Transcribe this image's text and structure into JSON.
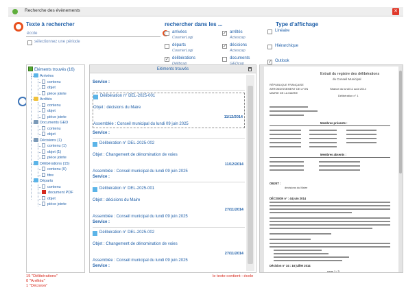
{
  "window": {
    "title": "Recherche des évènements"
  },
  "search": {
    "title": "Texte à rechercher",
    "value": "école",
    "period_label": "sélectionnez une période"
  },
  "where": {
    "title": "rechercher dans les ...",
    "options": [
      {
        "label": "arrivées",
        "sub": "CourrierLogi",
        "checked": false
      },
      {
        "label": "départs",
        "sub": "CourrierLogi",
        "checked": false
      },
      {
        "label": "délibérations",
        "sub": "Délibcap",
        "checked": true
      },
      {
        "label": "arrêtés",
        "sub": "Actescap",
        "checked": true
      },
      {
        "label": "décisions",
        "sub": "Actescap",
        "checked": true
      },
      {
        "label": "documents",
        "sub": "GEDcap",
        "checked": false
      }
    ]
  },
  "display": {
    "title": "Type d'affichage",
    "options": [
      {
        "label": "Linéaire",
        "checked": false
      },
      {
        "label": "Hiérarchique",
        "checked": false
      },
      {
        "label": "Outlook",
        "checked": true
      }
    ]
  },
  "tree": {
    "header": "Eléments trouvés (16)",
    "nodes": [
      {
        "label": "Arrivées",
        "type": "folder",
        "color": "#5bb4e8"
      },
      {
        "label": "contenu",
        "type": "doc"
      },
      {
        "label": "objet",
        "type": "doc"
      },
      {
        "label": "pièce jointe",
        "type": "doc"
      },
      {
        "label": "Arrêtés",
        "type": "folder",
        "color": "#f0c13a"
      },
      {
        "label": "contenu",
        "type": "doc"
      },
      {
        "label": "objet",
        "type": "doc"
      },
      {
        "label": "pièce jointe",
        "type": "doc"
      },
      {
        "label": "Documents GED",
        "type": "folder",
        "color": "#7b9ab8"
      },
      {
        "label": "contenu",
        "type": "doc"
      },
      {
        "label": "objet",
        "type": "doc"
      },
      {
        "label": "Décisions (1)",
        "type": "folder",
        "color": "#7b9ab8"
      },
      {
        "label": "contenu (1)",
        "type": "doc"
      },
      {
        "label": "objet (1)",
        "type": "doc"
      },
      {
        "label": "pièce jointe",
        "type": "doc"
      },
      {
        "label": "Délibérations (15)",
        "type": "folder",
        "color": "#5bb4e8"
      },
      {
        "label": "contenu (0)",
        "type": "doc"
      },
      {
        "label": "titre",
        "type": "doc"
      },
      {
        "label": "Départs",
        "type": "folder",
        "color": "#5bb4e8"
      },
      {
        "label": "contenu",
        "type": "doc"
      },
      {
        "label": "document PDF",
        "type": "pdf"
      },
      {
        "label": "objet",
        "type": "doc"
      },
      {
        "label": "pièce jointe",
        "type": "doc"
      }
    ]
  },
  "status": {
    "left": [
      "15 \"Délibérations\"",
      "0 \"Arrêtés\"",
      "1 \"Décision\""
    ],
    "right": "le texte contient : école"
  },
  "results": {
    "header": "Eléments trouvés",
    "items": [
      {
        "service": "Service :"
      },
      {
        "delib": "Délibération n° DEL-2025-001",
        "objet": "Objet : décisions du Maire",
        "date": "11/12/2014",
        "assembly": "Assemblée : Conseil municipal du lundi 09 juin 2025",
        "selected": true
      },
      {
        "service": "Service :"
      },
      {
        "delib": "Délibération n° DEL-2025-002",
        "objet": "Objet : Changement de dénomination de voies",
        "date": "11/12/2014",
        "assembly": "Assemblée : Conseil municipal du lundi 09 juin 2025"
      },
      {
        "service": "Service :"
      },
      {
        "delib": "Délibération n° DEL-2025-001",
        "objet": "Objet : décisions du Maire",
        "date": "27/11/2014",
        "assembly": "Assemblée : Conseil municipal du lundi 09 juin 2025"
      },
      {
        "service": "Service :"
      },
      {
        "delib": "Délibération n° DEL-2025-002",
        "objet": "Objet : Changement de dénomination de voies",
        "date": "27/11/2014",
        "assembly": "Assemblée : Conseil municipal du lundi 09 juin 2025"
      },
      {
        "service": "Service :"
      }
    ]
  },
  "preview": {
    "title": "Extrait du registre des délibérations",
    "subtitle1": "du Conseil Municipal",
    "subtitle2": "Séance du lundi 11 août 2014",
    "subtitle3": "Délibération n° 1",
    "header_left": [
      "RÉPUBLIQUE FRANÇAISE",
      "ARRONDISSEMENT DE LYON",
      "MAIRIE DE LA MAIRIE"
    ],
    "objet": "OBJET :",
    "objet_value": "décisions du Maire",
    "section1": "Membres présents :",
    "section2": "Membres absents :",
    "section3": "DÉCISION n° : 44 juin 2014",
    "section4": "Décision n° 34 : 16 juillet 2014",
    "page_label": "page 1 / 3"
  }
}
